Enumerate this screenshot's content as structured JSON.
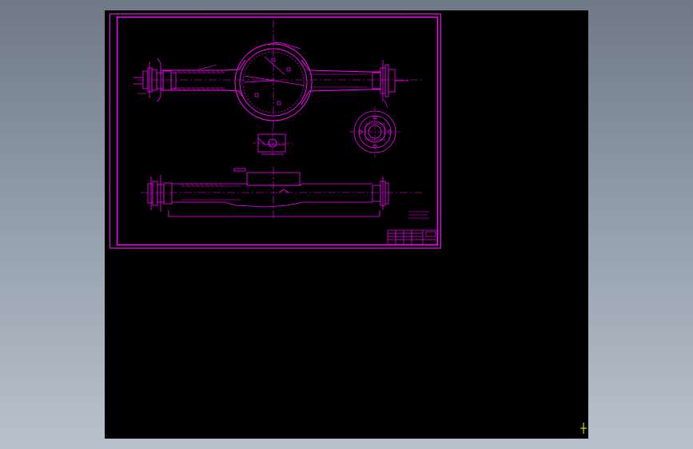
{
  "app": {
    "background": "#000000",
    "line_color": "#ff00ff",
    "center_line_color": "#ff00ff",
    "cursor_color": "#ffff00"
  },
  "drawing": {
    "title_block_text": "",
    "note_text": ""
  }
}
